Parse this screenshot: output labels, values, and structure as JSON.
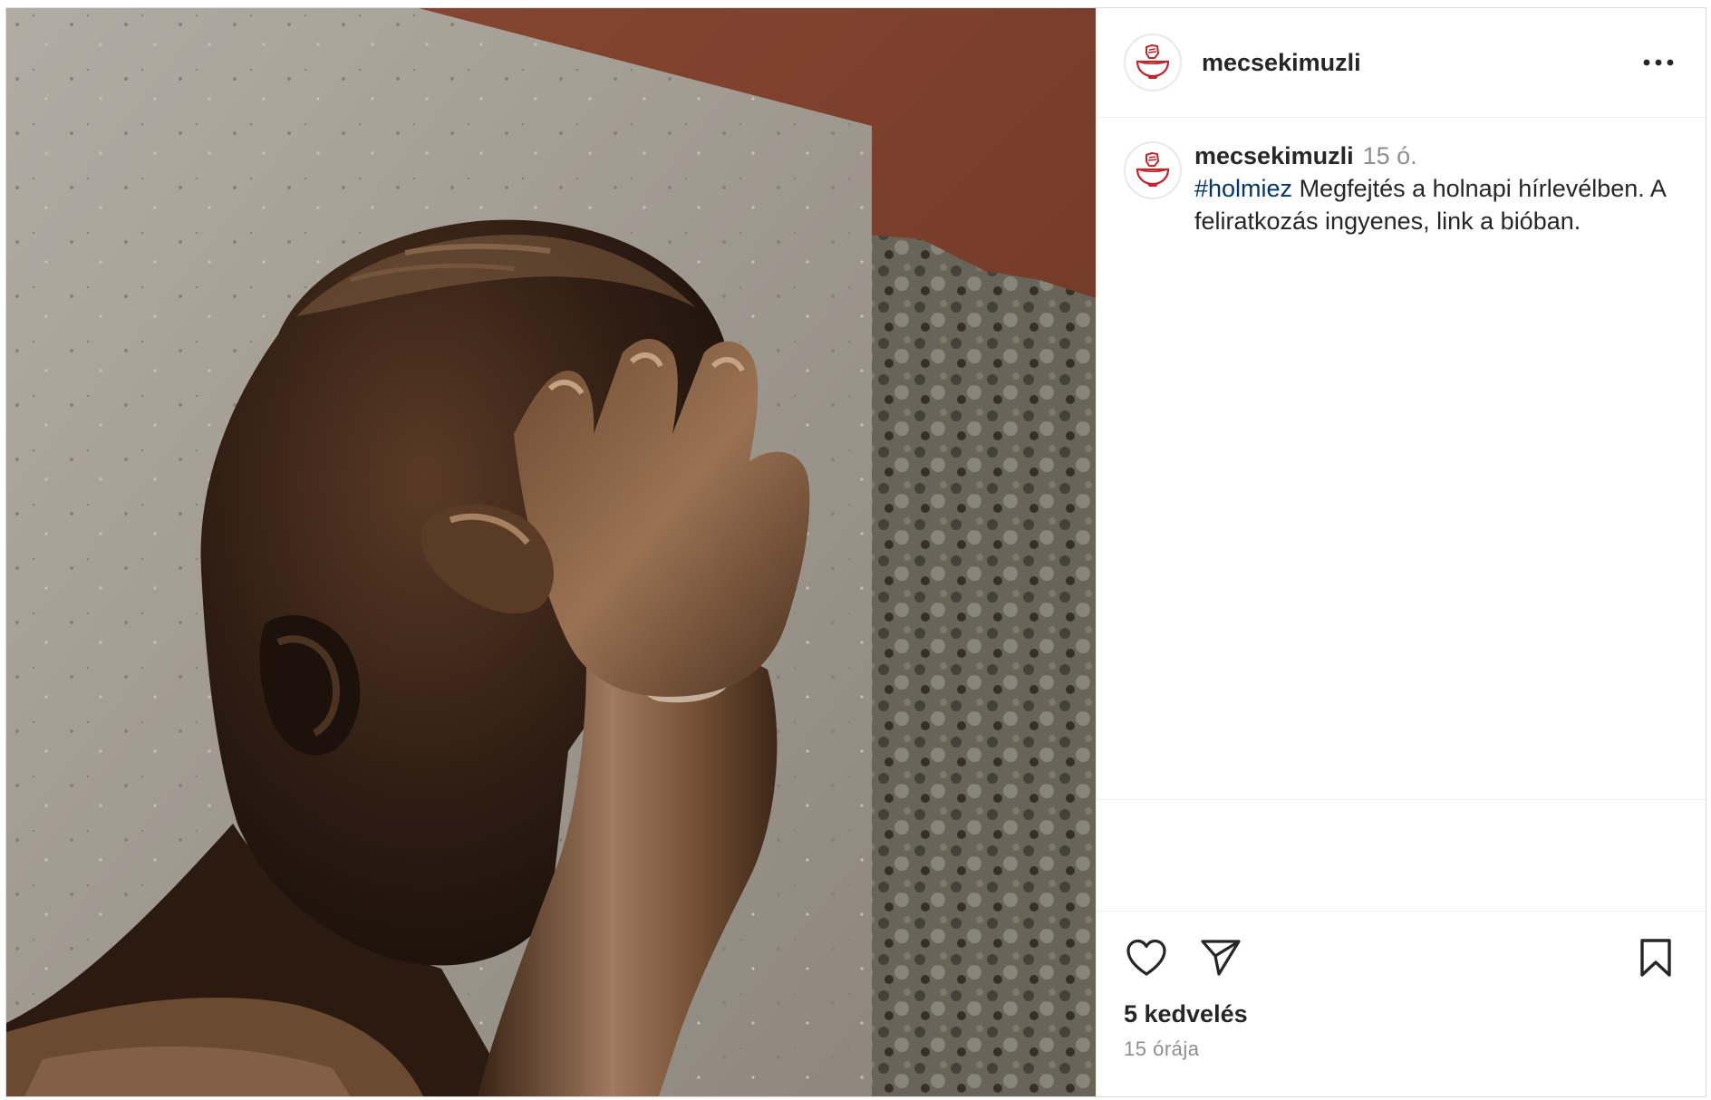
{
  "post": {
    "username": "mecsekimuzli",
    "image_alt": "Bronze statue of a man covering his face with his hand in front of a stone slab",
    "icons": {
      "avatar": "soup-bowl-logo-icon",
      "more": "more-options-icon",
      "like": "heart-icon",
      "share": "paper-plane-icon",
      "save": "bookmark-icon"
    }
  },
  "caption": {
    "username": "mecsekimuzli",
    "time_short": "15 ó.",
    "hashtag": "#holmiez",
    "text": " Megfejtés a holnapi hírlevélben. A feliratkozás ingyenes, link a bióban."
  },
  "footer": {
    "likes": "5 kedvelés",
    "time_long": "15 órája"
  },
  "colors": {
    "brand_red": "#c0272d",
    "hashtag": "#00376b",
    "muted": "#8e8e8e"
  }
}
